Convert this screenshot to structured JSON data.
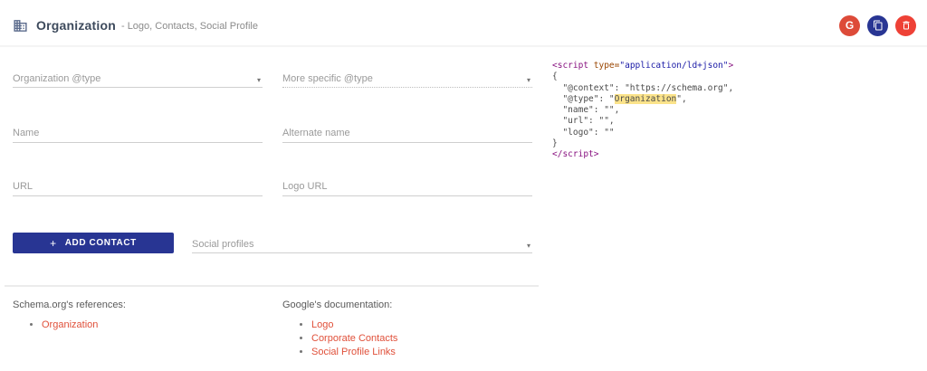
{
  "header": {
    "title": "Organization",
    "subtitle": "- Logo, Contacts, Social Profile"
  },
  "toolbar": {
    "google_label": "G"
  },
  "form": {
    "org_type_placeholder": "Organization @type",
    "more_specific_type_placeholder": "More specific @type",
    "name_placeholder": "Name",
    "alternate_name_placeholder": "Alternate name",
    "url_placeholder": "URL",
    "logo_url_placeholder": "Logo URL",
    "add_contact_plus": "+",
    "add_contact_label": "ADD CONTACT",
    "social_profiles_placeholder": "Social profiles",
    "dropdown_arrow": "▾"
  },
  "code": {
    "lines": [
      [
        {
          "t": "<script",
          "c": "tag"
        },
        {
          "t": " type=",
          "c": "attr"
        },
        {
          "t": "\"application/ld+json\"",
          "c": "str"
        },
        {
          "t": ">",
          "c": "tag"
        }
      ],
      [
        {
          "t": "{",
          "c": "plain"
        }
      ],
      [
        {
          "t": "  \"@context\": \"https://schema.org\",",
          "c": "plain"
        }
      ],
      [
        {
          "t": "  \"@type\": \"",
          "c": "plain"
        },
        {
          "t": "Organization",
          "c": "hl"
        },
        {
          "t": "\",",
          "c": "plain"
        }
      ],
      [
        {
          "t": "  \"name\": \"\",",
          "c": "plain"
        }
      ],
      [
        {
          "t": "  \"url\": \"\",",
          "c": "plain"
        }
      ],
      [
        {
          "t": "  \"logo\": \"\"",
          "c": "plain"
        }
      ],
      [
        {
          "t": "}",
          "c": "plain"
        }
      ],
      [
        {
          "t": "</script>",
          "c": "tag"
        }
      ]
    ]
  },
  "references": {
    "schema_heading": "Schema.org's references:",
    "schema_links": [
      "Organization"
    ],
    "google_heading": "Google's documentation:",
    "google_links": [
      "Logo",
      "Corporate Contacts",
      "Social Profile Links"
    ]
  },
  "colors": {
    "accent_navy": "#283593",
    "google_red": "#dd4b39",
    "delete_red": "#ee4136",
    "link_red": "#e0503a",
    "code_highlight_bg": "#fbe38a",
    "title_text": "#3d4a5c"
  }
}
